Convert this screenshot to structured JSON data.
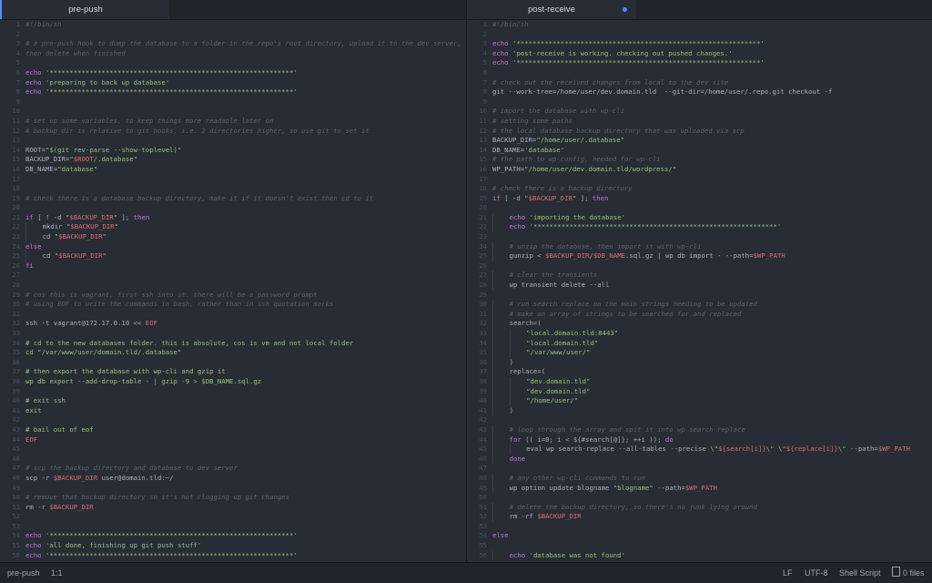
{
  "left": {
    "tab": "pre-push",
    "lines": [
      [
        [
          "c",
          "#!/bin/sh"
        ]
      ],
      [],
      [
        [
          "c",
          "# a pre-push hook to dump the database to a folder in the repo's root directory, upload it to the dev server,"
        ]
      ],
      [
        [
          "c",
          "then delete when finished"
        ]
      ],
      [],
      [
        [
          "k",
          "echo "
        ],
        [
          "s",
          "'*************************************************************'"
        ]
      ],
      [
        [
          "k",
          "echo "
        ],
        [
          "s",
          "'preparing to back up database'"
        ]
      ],
      [
        [
          "k",
          "echo "
        ],
        [
          "s",
          "'*************************************************************'"
        ]
      ],
      [],
      [],
      [
        [
          "c",
          "# set up some variables, to keep things more readable later on"
        ]
      ],
      [
        [
          "c",
          "# backup_dir is relative to git hooks, i.e. 2 directories higher, so use git to set it"
        ]
      ],
      [],
      [
        [
          "t",
          "ROOT="
        ],
        [
          "s",
          "\"$(git rev-parse --show-toplevel)\""
        ]
      ],
      [
        [
          "t",
          "BACKUP_DIR="
        ],
        [
          "s",
          "\""
        ],
        [
          "v",
          "$ROOT"
        ],
        [
          "s",
          "/.database\""
        ]
      ],
      [
        [
          "t",
          "DB_NAME="
        ],
        [
          "s",
          "\"database\""
        ]
      ],
      [],
      [],
      [
        [
          "c",
          "# check there is a database backup directory, make it if it doesn't exist then cd to it"
        ]
      ],
      [],
      [
        [
          "k",
          "if "
        ],
        [
          "t",
          "[ ! -d "
        ],
        [
          "s",
          "\""
        ],
        [
          "v",
          "$BACKUP_DIR"
        ],
        [
          "s",
          "\""
        ],
        [
          "t",
          " ]; "
        ],
        [
          "k",
          "then"
        ]
      ],
      [
        [
          "i",
          "    "
        ],
        [
          "t",
          "mkdir "
        ],
        [
          "s",
          "\""
        ],
        [
          "v",
          "$BACKUP_DIR"
        ],
        [
          "s",
          "\""
        ]
      ],
      [
        [
          "i",
          "    "
        ],
        [
          "t",
          "cd "
        ],
        [
          "s",
          "\""
        ],
        [
          "v",
          "$BACKUP_DIR"
        ],
        [
          "s",
          "\""
        ]
      ],
      [
        [
          "k",
          "else"
        ]
      ],
      [
        [
          "i",
          "    "
        ],
        [
          "t",
          "cd "
        ],
        [
          "s",
          "\""
        ],
        [
          "v",
          "$BACKUP_DIR"
        ],
        [
          "s",
          "\""
        ]
      ],
      [
        [
          "k",
          "fi"
        ]
      ],
      [],
      [],
      [
        [
          "c",
          "# cos this is vagrant, first ssh into it. there will be a password prompt"
        ]
      ],
      [
        [
          "c",
          "# using EOF to write the commands in bash, rather than in ssh quotation marks"
        ]
      ],
      [],
      [
        [
          "t",
          "ssh -t vagrant@172.17.0.10 << "
        ],
        [
          "v",
          "EOF"
        ]
      ],
      [],
      [
        [
          "s",
          "# cd to the new databases folder. this is absolute, cos is vm and not local folder"
        ]
      ],
      [
        [
          "s",
          "cd \"/var/www/user/domain.tld/.database\""
        ]
      ],
      [],
      [
        [
          "s",
          "# then export the database with wp-cli and gzip it"
        ]
      ],
      [
        [
          "s",
          "wp db export --add-drop-table - | gzip -9 > $DB_NAME.sql.gz"
        ]
      ],
      [],
      [
        [
          "s",
          "# exit ssh"
        ]
      ],
      [
        [
          "s",
          "exit"
        ]
      ],
      [],
      [
        [
          "s",
          "# bail out of eof"
        ]
      ],
      [
        [
          "v",
          "EOF"
        ]
      ],
      [],
      [],
      [
        [
          "c",
          "# scp the backup directory and database to dev server"
        ]
      ],
      [
        [
          "t",
          "scp -r "
        ],
        [
          "v",
          "$BACKUP_DIR"
        ],
        [
          "t",
          " user@domain.tld:~/"
        ]
      ],
      [],
      [
        [
          "c",
          "# remove that backup directory so it's not clogging up git changes"
        ]
      ],
      [
        [
          "t",
          "rm -r "
        ],
        [
          "v",
          "$BACKUP_DIR"
        ]
      ],
      [],
      [],
      [
        [
          "k",
          "echo "
        ],
        [
          "s",
          "'*************************************************************'"
        ]
      ],
      [
        [
          "k",
          "echo "
        ],
        [
          "s",
          "'all done, finishing up git push stuff'"
        ]
      ],
      [
        [
          "k",
          "echo "
        ],
        [
          "s",
          "'*************************************************************'"
        ]
      ]
    ]
  },
  "right": {
    "tab": "post-receive",
    "lines": [
      [
        [
          "c",
          "#!/bin/sh"
        ]
      ],
      [],
      [
        [
          "k",
          "echo "
        ],
        [
          "s",
          "'*************************************************************'"
        ]
      ],
      [
        [
          "k",
          "echo "
        ],
        [
          "s",
          "'post-receive is working. checking out pushed changes.'"
        ]
      ],
      [
        [
          "k",
          "echo "
        ],
        [
          "s",
          "'*************************************************************'"
        ]
      ],
      [],
      [
        [
          "c",
          "# check out the received changes from local to the dev site"
        ]
      ],
      [
        [
          "t",
          "git --work-tree=/home/user/dev.domain.tld  --git-dir=/home/user/.repo.git checkout -f"
        ]
      ],
      [],
      [
        [
          "c",
          "# import the database with wp-cli"
        ]
      ],
      [
        [
          "c",
          "# setting some paths"
        ]
      ],
      [
        [
          "c",
          "# the local database backup directory that was uploaded via scp"
        ]
      ],
      [
        [
          "t",
          "BACKUP_DIR="
        ],
        [
          "s",
          "\"/home/user/.database\""
        ]
      ],
      [
        [
          "t",
          "DB_NAME="
        ],
        [
          "s",
          "'database'"
        ]
      ],
      [
        [
          "c",
          "# the path to wp-config, needed for wp-cli"
        ]
      ],
      [
        [
          "t",
          "WP_PATH="
        ],
        [
          "s",
          "\"/home/user/dev.domain.tld/wordpress/\""
        ]
      ],
      [],
      [
        [
          "c",
          "# check there is a backup directory"
        ]
      ],
      [
        [
          "k",
          "if "
        ],
        [
          "t",
          "[ -d "
        ],
        [
          "s",
          "\""
        ],
        [
          "v",
          "$BACKUP_DIR"
        ],
        [
          "s",
          "\""
        ],
        [
          "t",
          " ]; "
        ],
        [
          "k",
          "then"
        ]
      ],
      [],
      [
        [
          "i",
          "    "
        ],
        [
          "k",
          "echo "
        ],
        [
          "s",
          "'importing the database'"
        ]
      ],
      [
        [
          "i",
          "    "
        ],
        [
          "k",
          "echo "
        ],
        [
          "s",
          "'*************************************************************'"
        ]
      ],
      [],
      [
        [
          "i",
          "    "
        ],
        [
          "c",
          "# unzip the database, then import it with wp-cli"
        ]
      ],
      [
        [
          "i",
          "    "
        ],
        [
          "t",
          "gunzip < "
        ],
        [
          "v",
          "$BACKUP_DIR"
        ],
        [
          "t",
          "/"
        ],
        [
          "v",
          "$DB_NAME"
        ],
        [
          "t",
          ".sql.gz | wp db import - --path="
        ],
        [
          "v",
          "$WP_PATH"
        ]
      ],
      [],
      [
        [
          "i",
          "    "
        ],
        [
          "c",
          "# clear the transients"
        ]
      ],
      [
        [
          "i",
          "    "
        ],
        [
          "t",
          "wp transient delete --all"
        ]
      ],
      [],
      [
        [
          "i",
          "    "
        ],
        [
          "c",
          "# run search replace on the main strings needing to be updated"
        ]
      ],
      [
        [
          "i",
          "    "
        ],
        [
          "c",
          "# make an array of strings to be searched for and replaced"
        ]
      ],
      [
        [
          "i",
          "    "
        ],
        [
          "t",
          "search=("
        ]
      ],
      [
        [
          "i",
          "    "
        ],
        [
          "i",
          "    "
        ],
        [
          "s",
          "\"local.domain.tld:8443\""
        ]
      ],
      [
        [
          "i",
          "    "
        ],
        [
          "i",
          "    "
        ],
        [
          "s",
          "\"local.domain.tld\""
        ]
      ],
      [
        [
          "i",
          "    "
        ],
        [
          "i",
          "    "
        ],
        [
          "s",
          "\"/var/www/user/\""
        ]
      ],
      [
        [
          "i",
          "    "
        ],
        [
          "t",
          ")"
        ]
      ],
      [
        [
          "i",
          "    "
        ],
        [
          "t",
          "replace=("
        ]
      ],
      [
        [
          "i",
          "    "
        ],
        [
          "i",
          "    "
        ],
        [
          "s",
          "\"dev.domain.tld\""
        ]
      ],
      [
        [
          "i",
          "    "
        ],
        [
          "i",
          "    "
        ],
        [
          "s",
          "\"dev.domain.tld\""
        ]
      ],
      [
        [
          "i",
          "    "
        ],
        [
          "i",
          "    "
        ],
        [
          "s",
          "\"/home/user/\""
        ]
      ],
      [
        [
          "i",
          "    "
        ],
        [
          "t",
          ")"
        ]
      ],
      [],
      [
        [
          "i",
          "    "
        ],
        [
          "c",
          "# loop through the array and spit it into wp search-replace"
        ]
      ],
      [
        [
          "i",
          "    "
        ],
        [
          "k",
          "for "
        ],
        [
          "t",
          "(( i=0; i < ${#search[@]}; ++i )); "
        ],
        [
          "k",
          "do"
        ]
      ],
      [
        [
          "i",
          "    "
        ],
        [
          "i",
          "    "
        ],
        [
          "t",
          "eval wp search-replace --all-tables --precise "
        ],
        [
          "s",
          "\\\""
        ],
        [
          "v",
          "${search[i]}"
        ],
        [
          "s",
          "\\\" \\\""
        ],
        [
          "v",
          "${replace[i]}"
        ],
        [
          "s",
          "\\\""
        ],
        [
          "t",
          " --path="
        ],
        [
          "v",
          "$WP_PATH"
        ]
      ],
      [
        [
          "i",
          "    "
        ],
        [
          "k",
          "done"
        ]
      ],
      [],
      [
        [
          "i",
          "    "
        ],
        [
          "c",
          "# any other wp-cli commands to run"
        ]
      ],
      [
        [
          "i",
          "    "
        ],
        [
          "t",
          "wp option update blogname "
        ],
        [
          "s",
          "\"blogname\""
        ],
        [
          "t",
          " --path="
        ],
        [
          "v",
          "$WP_PATH"
        ]
      ],
      [],
      [
        [
          "i",
          "    "
        ],
        [
          "c",
          "# delete the backup directory, so there's no junk lying around"
        ]
      ],
      [
        [
          "i",
          "    "
        ],
        [
          "t",
          "rm -rf "
        ],
        [
          "v",
          "$BACKUP_DIR"
        ]
      ],
      [],
      [
        [
          "k",
          "else"
        ]
      ],
      [],
      [
        [
          "i",
          "    "
        ],
        [
          "k",
          "echo "
        ],
        [
          "s",
          "'database was not found'"
        ]
      ]
    ]
  },
  "status": {
    "file": "pre-push",
    "cursor": "1:1",
    "line_ending": "LF",
    "encoding": "UTF-8",
    "grammar": "Shell Script",
    "files": "0 files"
  }
}
